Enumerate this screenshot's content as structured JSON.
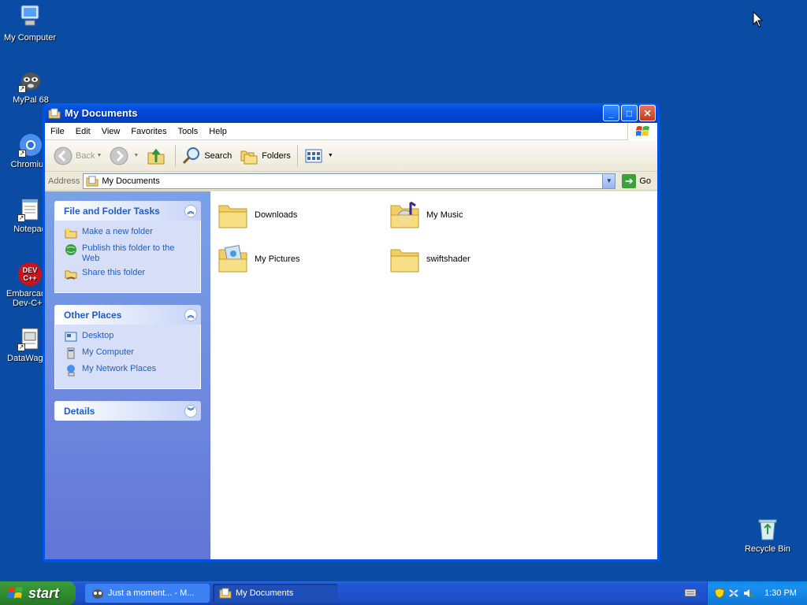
{
  "desktop": {
    "icons": [
      {
        "label": "My Computer",
        "icon": "my-computer-icon"
      },
      {
        "label": "MyPal 68",
        "icon": "mypal-icon"
      },
      {
        "label": "Chromium",
        "icon": "chromium-icon"
      },
      {
        "label": "Notepad",
        "icon": "notepad-icon"
      },
      {
        "label": "Embarcadero Dev-C++",
        "icon": "devcpp-icon"
      },
      {
        "label": "DataWagon",
        "icon": "datawagon-icon"
      },
      {
        "label": "Recycle Bin",
        "icon": "recycle-bin-icon"
      }
    ]
  },
  "window": {
    "title": "My Documents",
    "menu": [
      "File",
      "Edit",
      "View",
      "Favorites",
      "Tools",
      "Help"
    ],
    "toolbar": {
      "back": "Back",
      "search": "Search",
      "folders": "Folders"
    },
    "address": {
      "label": "Address",
      "value": "My Documents",
      "go": "Go"
    },
    "sidebar": {
      "file_tasks": {
        "title": "File and Folder Tasks",
        "items": [
          "Make a new folder",
          "Publish this folder to the Web",
          "Share this folder"
        ]
      },
      "other_places": {
        "title": "Other Places",
        "items": [
          "Desktop",
          "My Computer",
          "My Network Places"
        ]
      },
      "details": {
        "title": "Details"
      }
    },
    "files": [
      {
        "name": "Downloads",
        "icon": "folder-icon"
      },
      {
        "name": "My Music",
        "icon": "music-folder-icon"
      },
      {
        "name": "My Pictures",
        "icon": "pictures-folder-icon"
      },
      {
        "name": "swiftshader",
        "icon": "folder-icon"
      }
    ]
  },
  "taskbar": {
    "start": "start",
    "tasks": [
      {
        "label": "Just a moment... - M...",
        "active": false
      },
      {
        "label": "My Documents",
        "active": true
      }
    ],
    "clock": "1:30 PM"
  },
  "colors": {
    "desktop": "#0a4ba3",
    "titlebar": "#0054e3",
    "link": "#215dc6",
    "start": "#2e8a2e"
  }
}
